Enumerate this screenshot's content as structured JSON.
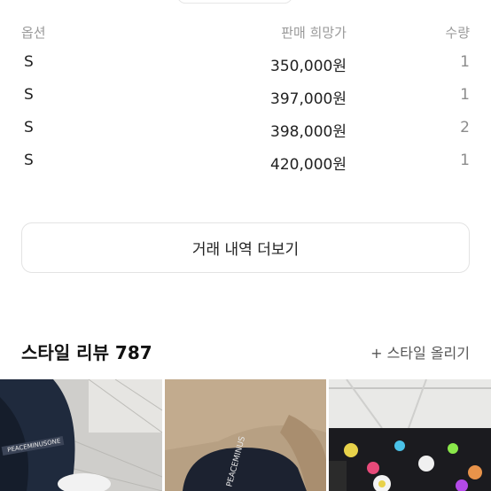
{
  "table": {
    "headers": {
      "option": "옵션",
      "price": "판매 희망가",
      "quantity": "수량"
    },
    "rows": [
      {
        "option": "S",
        "price": "350,000원",
        "quantity": "1"
      },
      {
        "option": "S",
        "price": "397,000원",
        "quantity": "1"
      },
      {
        "option": "S",
        "price": "398,000원",
        "quantity": "2"
      },
      {
        "option": "S",
        "price": "420,000원",
        "quantity": "1"
      }
    ]
  },
  "history_button": {
    "label": "거래 내역 더보기"
  },
  "reviews": {
    "title": "스타일 리뷰 787",
    "upload_label": "+ 스타일 올리기"
  },
  "photos": [
    {
      "icon": "review-photo-1"
    },
    {
      "icon": "review-photo-2"
    },
    {
      "icon": "review-photo-3"
    }
  ]
}
